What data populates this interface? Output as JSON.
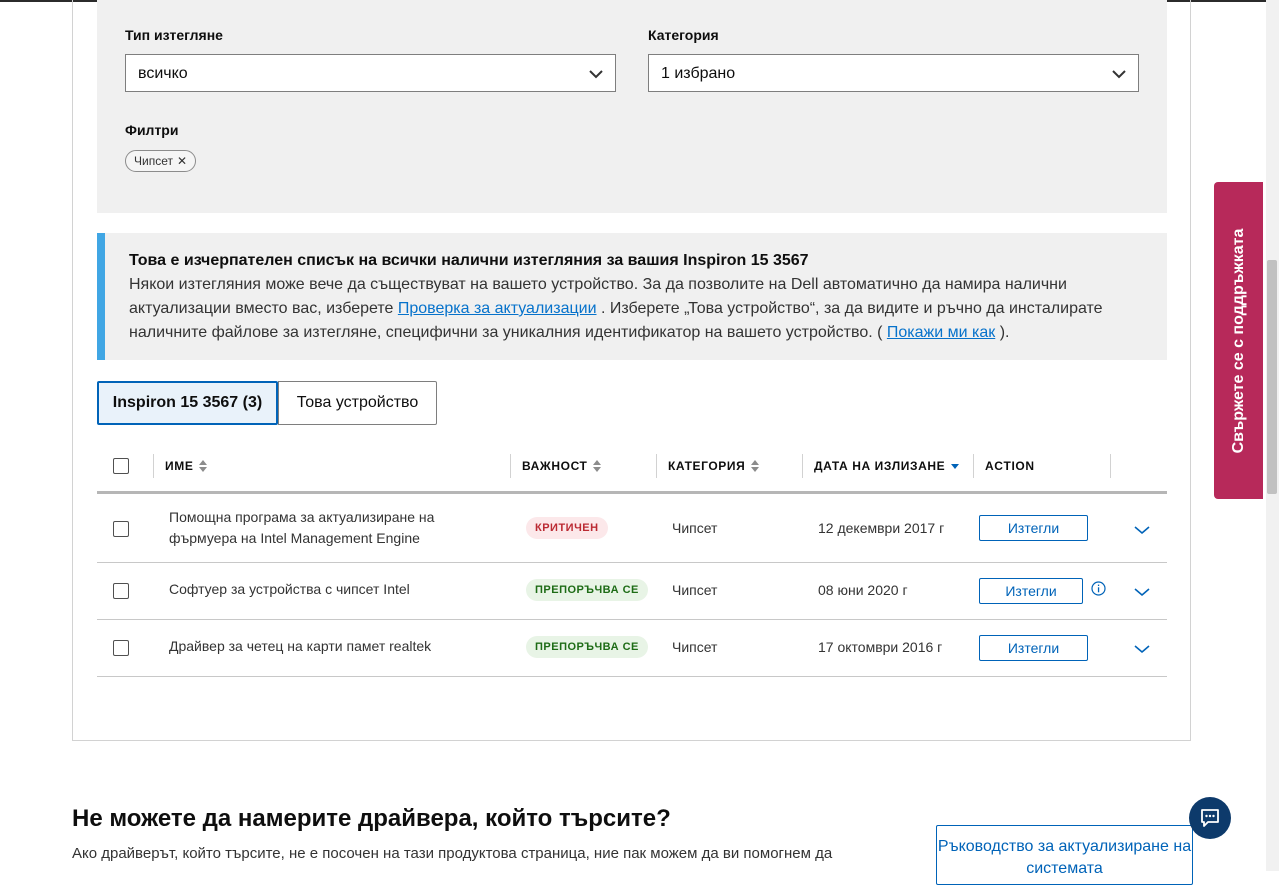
{
  "filters": {
    "download_type_label": "Тип изтегляне",
    "download_type_value": "всичко",
    "category_label": "Категория",
    "category_value": "1 избрано",
    "filters_label": "Филтри",
    "chip_label": "Чипсет"
  },
  "info": {
    "title": "Това е изчерпателен списък на всички налични изтегляния за вашия Inspiron 15 3567",
    "text1": "Някои изтегляния може вече да съществуват на вашето устройство. За да позволите на Dell автоматично да намира налични актуализации вместо вас, изберете ",
    "link1": "Проверка за актуализации",
    "text2": " . Изберете „Това устройство“, за да видите и ръчно да инсталирате наличните файлове за изтегляне, специфични за уникалния идентификатор на вашето устройство. ( ",
    "link2": "Покажи ми как",
    "text3": " )."
  },
  "tabs": {
    "product": "Inspiron 15 3567 (3)",
    "device": "Това устройство"
  },
  "table": {
    "headers": {
      "name": "ИМЕ",
      "importance": "ВАЖНОСТ",
      "category": "КАТЕГОРИЯ",
      "release_date": "ДАТА НА ИЗЛИЗАНЕ",
      "action": "ACTION"
    },
    "rows": [
      {
        "name": "Помощна програма за актуализиране на фърмуера на Intel Management Engine",
        "importance": "КРИТИЧЕН",
        "category": "Чипсет",
        "date": "12 декември 2017 г",
        "action": "Изтегли"
      },
      {
        "name": "Софтуер за устройства с чипсет Intel",
        "importance": "ПРЕПОРЪЧВА СЕ",
        "category": "Чипсет",
        "date": "08 юни 2020 г",
        "action": "Изтегли"
      },
      {
        "name": "Драйвер за четец на карти памет realtek",
        "importance": "ПРЕПОРЪЧВА СЕ",
        "category": "Чипсет",
        "date": "17 октомври 2016 г",
        "action": "Изтегли"
      }
    ]
  },
  "support_tab": "Свържете се с поддръжката",
  "bottom": {
    "heading": "Не можете да намерите драйвера, който търсите?",
    "paragraph": "Ако драйверът, който търсите, не е посочен на тази продуктова страница, ние пак можем да ви помогнем да",
    "guide_button": "Ръководство за актуализиране на системата"
  },
  "colors": {
    "primary_blue": "#0063b8",
    "info_accent": "#40a6e4",
    "support_tab": "#b7295a",
    "critical": "#bb2a33",
    "recommended": "#1e6c16"
  }
}
